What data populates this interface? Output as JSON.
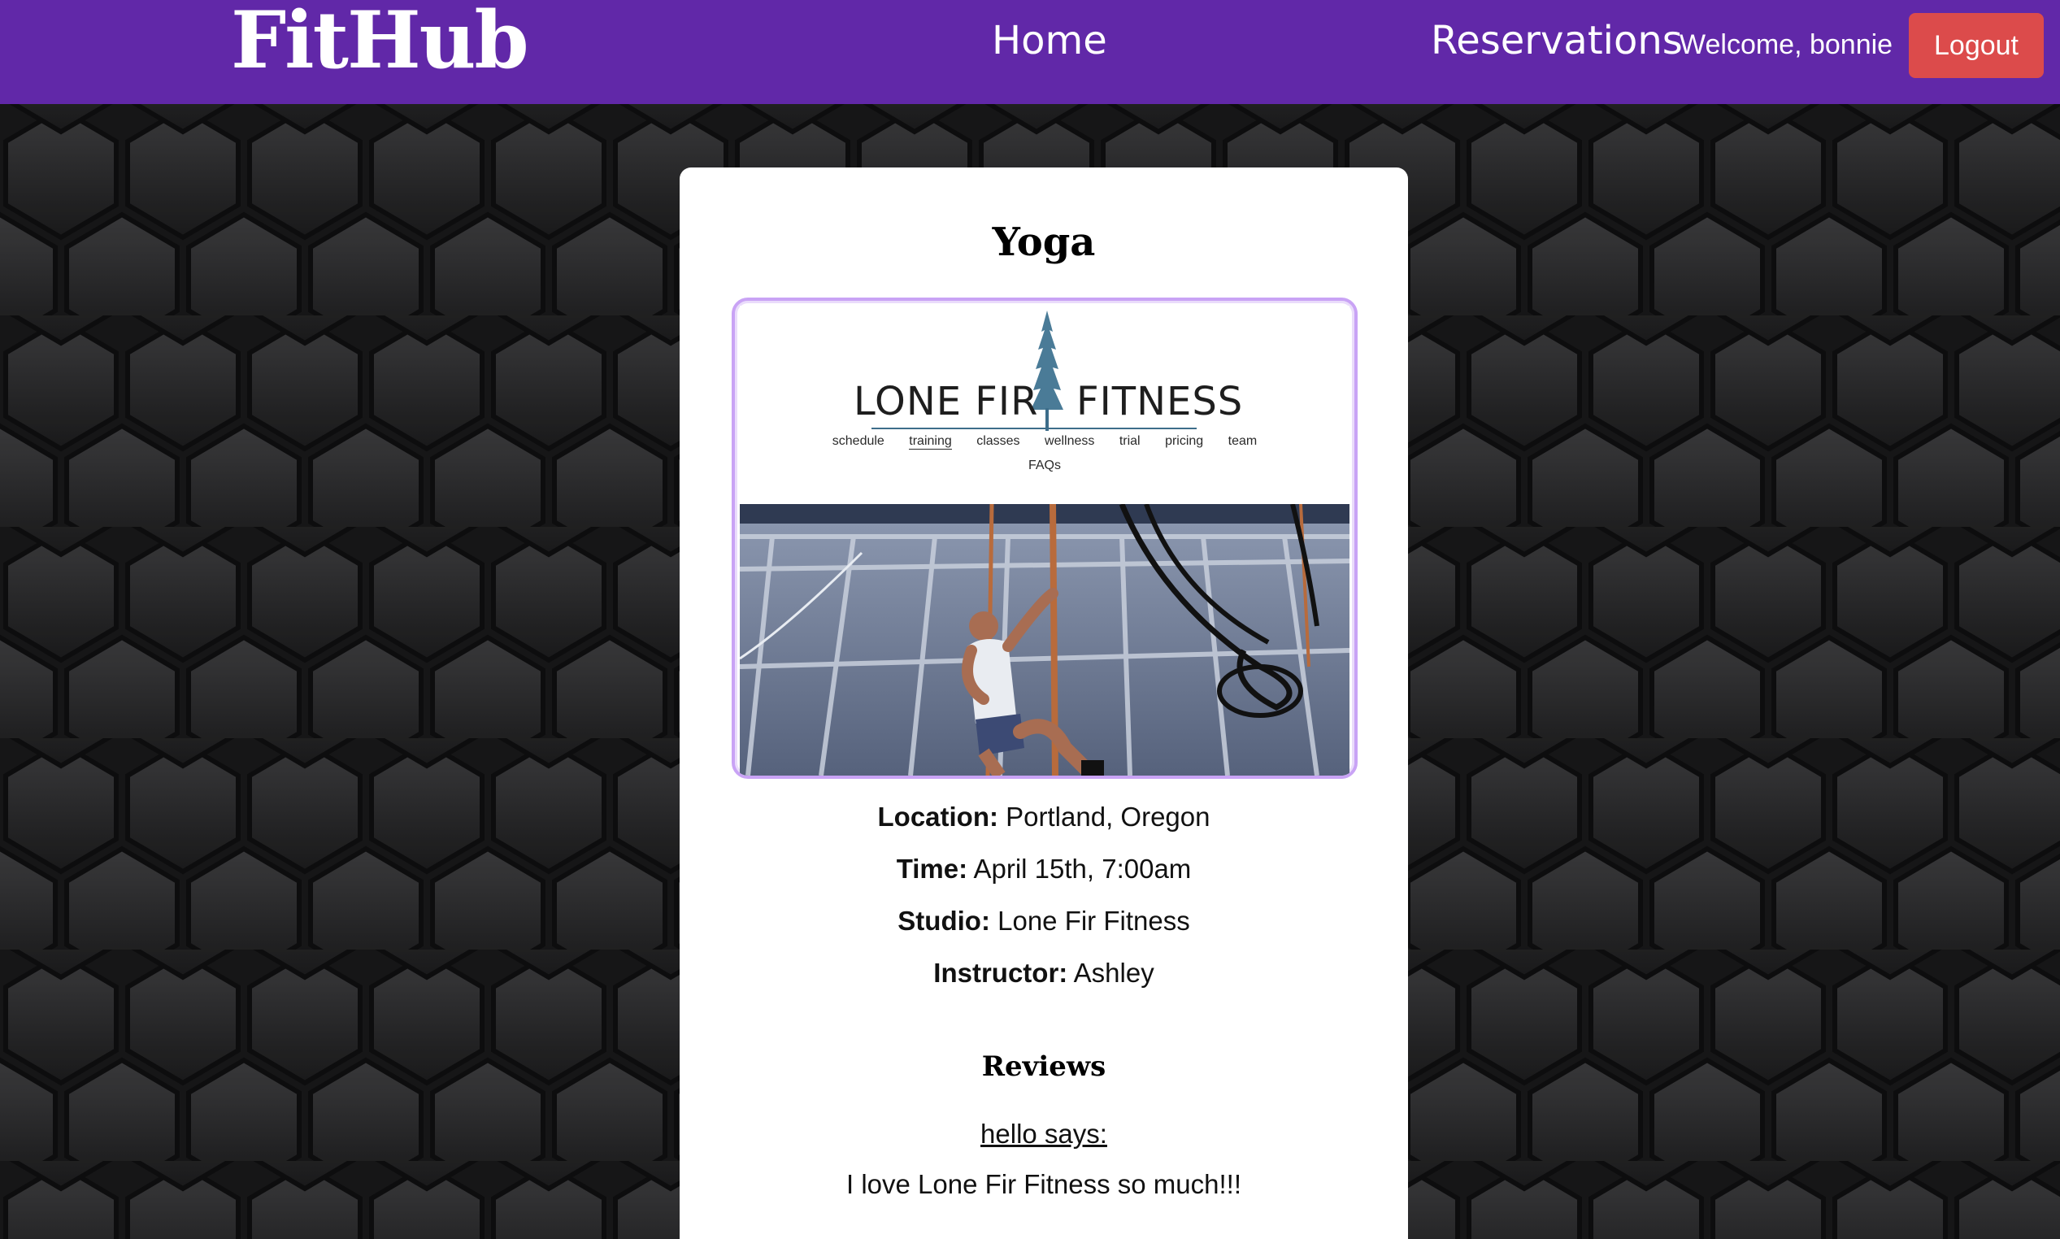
{
  "navbar": {
    "brand": "FitHub",
    "links": [
      {
        "label": "Home"
      },
      {
        "label": "Reservations"
      }
    ],
    "welcome": "Welcome, bonnie",
    "logout_label": "Logout",
    "color": "#6128a8",
    "logout_color": "#dc4b4b"
  },
  "class_detail": {
    "title": "Yoga",
    "image": {
      "logo_left": "LONE FIR",
      "logo_right": "FITNESS",
      "nav": [
        "schedule",
        "training",
        "classes",
        "wellness",
        "trial",
        "pricing",
        "team"
      ],
      "nav_active": "training",
      "nav_second_row": "FAQs",
      "frame_color": "#c9a3f5"
    },
    "fields": [
      {
        "label": "Location:",
        "value": "Portland, Oregon"
      },
      {
        "label": "Time:",
        "value": "April 15th, 7:00am"
      },
      {
        "label": "Studio:",
        "value": "Lone Fir Fitness"
      },
      {
        "label": "Instructor:",
        "value": "Ashley"
      }
    ]
  },
  "reviews": {
    "title": "Reviews",
    "items": [
      {
        "author": "hello says:",
        "text": "I love Lone Fir Fitness so much!!!"
      }
    ]
  }
}
